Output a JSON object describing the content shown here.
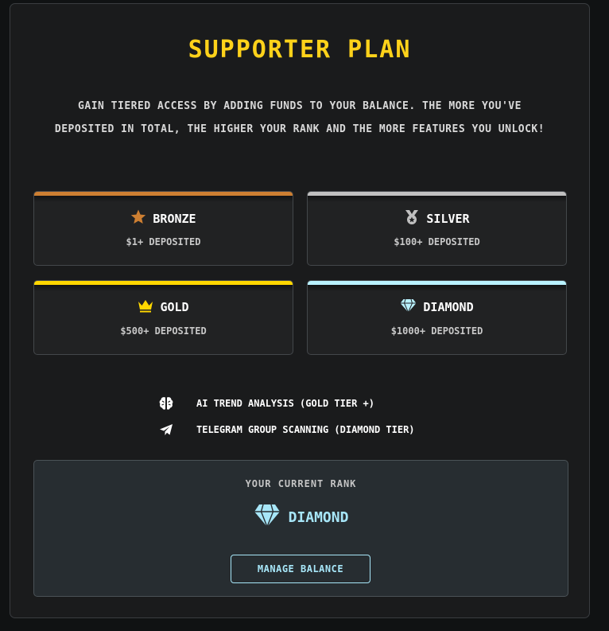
{
  "panel": {
    "title": "Supporter Plan",
    "description": "Gain tiered access by adding funds to your balance. The more you've deposited in total, the higher your rank and the more features you unlock!"
  },
  "tiers": [
    {
      "name": "Bronze",
      "requirement": "$1+ Deposited",
      "icon": "star-icon",
      "color": "#cd7f32"
    },
    {
      "name": "Silver",
      "requirement": "$100+ Deposited",
      "icon": "medal-icon",
      "color": "#c0c0c0"
    },
    {
      "name": "Gold",
      "requirement": "$500+ Deposited",
      "icon": "crown-icon",
      "color": "#ffd700"
    },
    {
      "name": "Diamond",
      "requirement": "$1000+ Deposited",
      "icon": "diamond-icon",
      "color": "#b9f2ff"
    }
  ],
  "features": [
    {
      "icon": "brain-icon",
      "text": "AI Trend Analysis (Gold Tier +)"
    },
    {
      "icon": "telegram-icon",
      "text": "Telegram Group Scanning (Diamond Tier)"
    }
  ],
  "current_rank": {
    "label": "Your Current Rank",
    "value": "Diamond",
    "icon": "diamond-icon",
    "color": "#a7e6f8"
  },
  "manage_button": {
    "label": "Manage Balance"
  },
  "colors": {
    "title": "#ffd21a",
    "accent": "#a7e6f8",
    "background": "#1a1b1c"
  }
}
